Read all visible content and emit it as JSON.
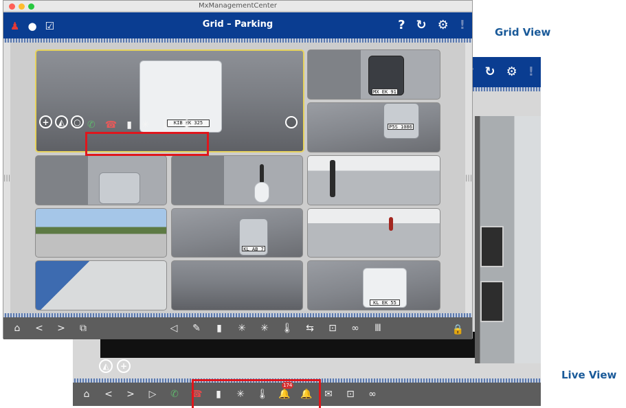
{
  "captions": {
    "grid_view": "Grid View",
    "live_view": "Live View"
  },
  "grid_window": {
    "app_title": "MxManagementCenter",
    "view_title": "Grid – Parking",
    "header_left_icons": [
      "alarm-bell-icon",
      "chat-bubble-icon",
      "checkbox-icon"
    ],
    "header_right_icons": {
      "help": "?",
      "refresh": "↻",
      "settings": "⚙",
      "alarm": "!"
    },
    "grid_cells": [
      {
        "id": "cam-entrance-car",
        "kind": "road",
        "active": true,
        "plate": "KIB EK 325"
      },
      {
        "id": "cam-black-car",
        "kind": "gate",
        "plate": "MX EK 91"
      },
      {
        "id": "cam-parked-car",
        "kind": "road2",
        "plate": "P5S 1086"
      },
      {
        "id": "cam-gate-left",
        "kind": "gate"
      },
      {
        "id": "cam-scooter",
        "kind": "gate"
      },
      {
        "id": "cam-cyclist",
        "kind": "sunny"
      },
      {
        "id": "cam-panorama",
        "kind": "pano"
      },
      {
        "id": "cam-car-leaving",
        "kind": "road2",
        "plate": "KL AB 7"
      },
      {
        "id": "cam-pedestrian",
        "kind": "sunny"
      },
      {
        "id": "cam-lobby",
        "kind": "lobby"
      },
      {
        "id": "cam-road-curve",
        "kind": "road"
      },
      {
        "id": "cam-white-car-front",
        "kind": "road2",
        "plate": "KL EK 55"
      }
    ],
    "cell_controls": {
      "add": "+",
      "ptz": "◭",
      "circle": "○"
    },
    "cell_actions": [
      {
        "name": "answer-call-icon",
        "glyph": "✆",
        "color": "green"
      },
      {
        "name": "hang-up-icon",
        "glyph": "☎",
        "color": "red"
      },
      {
        "name": "door-icon",
        "glyph": "▮"
      },
      {
        "name": "light-icon",
        "glyph": "✳"
      },
      {
        "name": "thermometer-icon",
        "glyph": "🌡"
      },
      {
        "name": "thermometer-alt-icon",
        "glyph": "🌡"
      }
    ],
    "toolbar_left": [
      {
        "name": "home-icon",
        "glyph": "⌂"
      },
      {
        "name": "back-icon",
        "glyph": "<"
      },
      {
        "name": "forward-icon",
        "glyph": ">"
      },
      {
        "name": "layout-icon",
        "glyph": "⧉"
      }
    ],
    "toolbar_center": [
      {
        "name": "speaker-icon",
        "glyph": "◁"
      },
      {
        "name": "microphone-icon",
        "glyph": "✎"
      },
      {
        "name": "door-icon",
        "glyph": "▮"
      },
      {
        "name": "light-on-icon",
        "glyph": "✳"
      },
      {
        "name": "light-off-icon",
        "glyph": "✳"
      },
      {
        "name": "thermometer-icon",
        "glyph": "🌡"
      },
      {
        "name": "switch-icon",
        "glyph": "⇆"
      },
      {
        "name": "snapshot-icon",
        "glyph": "⊡"
      },
      {
        "name": "link-icon",
        "glyph": "∞"
      },
      {
        "name": "barcode-icon",
        "glyph": "Ⅲ"
      }
    ],
    "toolbar_right": [
      {
        "name": "lock-icon",
        "glyph": "🔒"
      }
    ]
  },
  "live_window": {
    "header_right_icons": {
      "help": "?",
      "refresh": "↻",
      "settings": "⚙",
      "alarm": "!"
    },
    "controls": {
      "ptz": "◭",
      "add": "+"
    },
    "toolbar": [
      {
        "name": "home-icon",
        "glyph": "⌂"
      },
      {
        "name": "back-icon",
        "glyph": "<"
      },
      {
        "name": "forward-icon",
        "glyph": ">"
      },
      {
        "name": "play-icon",
        "glyph": "▷"
      },
      {
        "name": "answer-call-icon",
        "glyph": "✆",
        "color": "green"
      },
      {
        "name": "hang-up-icon",
        "glyph": "☎",
        "color": "red"
      },
      {
        "name": "door-icon",
        "glyph": "▮"
      },
      {
        "name": "light-icon",
        "glyph": "✳"
      },
      {
        "name": "thermometer-icon",
        "glyph": "🌡"
      },
      {
        "name": "alarm-icon",
        "glyph": "🔔",
        "badge": "174"
      },
      {
        "name": "bell-icon",
        "glyph": "🔔"
      },
      {
        "name": "mail-icon",
        "glyph": "✉"
      },
      {
        "name": "snapshot-icon",
        "glyph": "⊡"
      },
      {
        "name": "link-icon",
        "glyph": "∞"
      }
    ]
  },
  "colors": {
    "header_blue": "#0a3d91",
    "toolbar_gray": "#5d5d5d",
    "highlight_red": "#e0161c",
    "caption_blue": "#1a5a99",
    "active_cell_border": "#e7d35c"
  }
}
